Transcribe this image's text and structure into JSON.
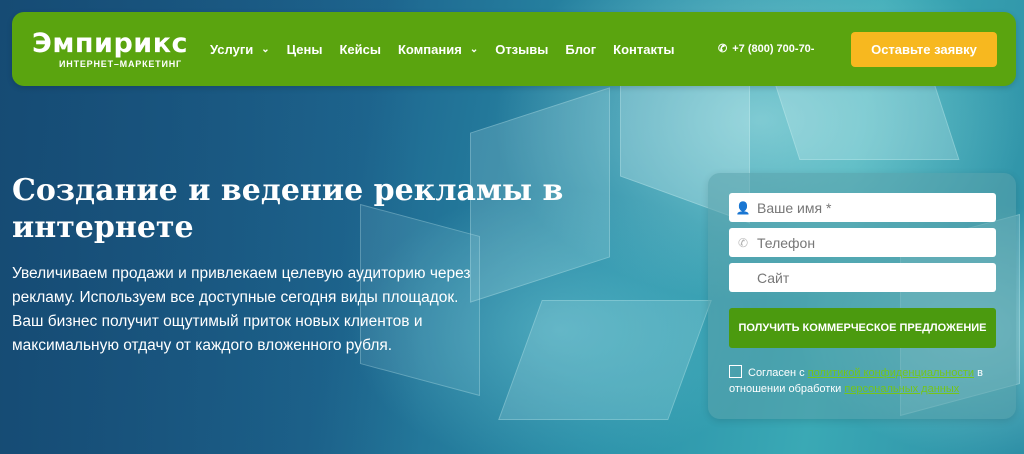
{
  "header": {
    "logo_title": "Эмпирикс",
    "logo_subtitle": "ИНТЕРНЕТ–МАРКЕТИНГ",
    "nav": [
      {
        "label": "Услуги",
        "dropdown": true
      },
      {
        "label": "Цены",
        "dropdown": false
      },
      {
        "label": "Кейсы",
        "dropdown": false
      },
      {
        "label": "Компания",
        "dropdown": true
      },
      {
        "label": "Отзывы",
        "dropdown": false
      },
      {
        "label": "Блог",
        "dropdown": false
      },
      {
        "label": "Контакты",
        "dropdown": false
      }
    ],
    "phone": "+7 (800) 700-70-",
    "cta_label": "Оставьте заявку",
    "colors": {
      "header_bg": "#5aa40f",
      "cta_bg": "#f7b81f"
    }
  },
  "hero": {
    "title": "Создание и ведение рекламы в интернете",
    "text": "Увеличиваем продажи и привлекаем целевую аудиторию через рекламу. Используем все доступные сегодня виды площадок. Ваш бизнес получит ощутимый приток новых клиентов и максимальную отдачу от каждого вложенного рубля."
  },
  "form": {
    "name_placeholder": "Ваше имя *",
    "phone_placeholder": "Телефон",
    "site_placeholder": "Сайт",
    "submit_label": "ПОЛУЧИТЬ КОММЕРЧЕСКОЕ ПРЕДЛОЖЕНИЕ",
    "consent_prefix": "Согласен с",
    "consent_link1": "политикой конфиденциальности",
    "consent_middle": "в отношении обработки",
    "consent_link2": "персональных данных",
    "colors": {
      "submit_bg": "#4b9a0f"
    }
  }
}
